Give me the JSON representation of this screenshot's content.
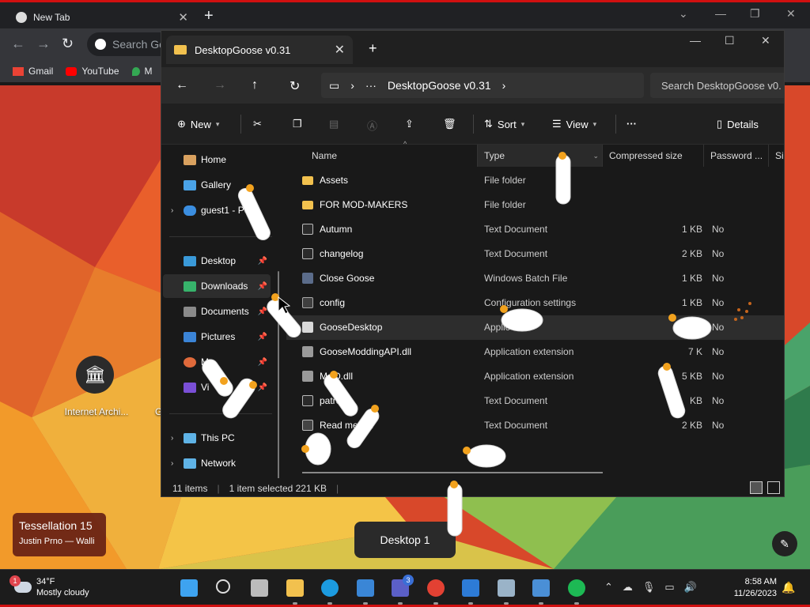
{
  "chrome": {
    "tab_title": "New Tab",
    "omnibox_placeholder": "Search Go",
    "bookmarks": [
      {
        "label": "Gmail",
        "icon": "gmail-icon",
        "color": "#ea4335"
      },
      {
        "label": "YouTube",
        "icon": "youtube-icon",
        "color": "#ff0000"
      },
      {
        "label": "M",
        "icon": "maps-icon",
        "color": "#34a853"
      }
    ]
  },
  "desktop": {
    "icon_label": "Internet Archi...",
    "icon_label_2": "G",
    "wallpaper_title": "Tessellation 15",
    "wallpaper_artist": "Justin Prno — Walli",
    "desktop_pill": "Desktop 1"
  },
  "explorer": {
    "tab_title": "DesktopGoose v0.31",
    "address_path": "DesktopGoose v0.31",
    "search_placeholder": "Search DesktopGoose v0.",
    "commands": {
      "new": "New",
      "sort": "Sort",
      "view": "View",
      "more": "···",
      "details": "Details"
    },
    "nav": [
      {
        "label": "Home",
        "icon": "home-icon",
        "color": "#d9a15f"
      },
      {
        "label": "Gallery",
        "icon": "gallery-icon",
        "color": "#4aa3e8"
      },
      {
        "label": "guest1 - Pe",
        "icon": "onedrive-icon",
        "color": "#3b8ee0"
      },
      {
        "label": "Desktop",
        "icon": "desktop-icon",
        "color": "#3a9ad9"
      },
      {
        "label": "Downloads",
        "icon": "download-icon",
        "color": "#37b36b"
      },
      {
        "label": "Documents",
        "icon": "documents-icon",
        "color": "#8a8a8a"
      },
      {
        "label": "Pictures",
        "icon": "pictures-icon",
        "color": "#3b84d6"
      },
      {
        "label": "M",
        "icon": "music-icon",
        "color": "#e06a3b"
      },
      {
        "label": "Vi",
        "icon": "videos-icon",
        "color": "#7a4fd6"
      },
      {
        "label": "This PC",
        "icon": "pc-icon",
        "color": "#5fb3e6"
      },
      {
        "label": "Network",
        "icon": "network-icon",
        "color": "#5fb3e6"
      }
    ],
    "columns": [
      "Name",
      "Type",
      "Compressed size",
      "Password ...",
      "Siz"
    ],
    "files": [
      {
        "name": "Assets",
        "type": "File folder",
        "size": "",
        "password": "",
        "icon": "ico-folder"
      },
      {
        "name": "FOR MOD-MAKERS",
        "type": "File folder",
        "size": "",
        "password": "",
        "icon": "ico-folder"
      },
      {
        "name": "Autumn",
        "type": "Text Document",
        "size": "1 KB",
        "password": "No",
        "icon": "ico-doc"
      },
      {
        "name": "changelog",
        "type": "Text Document",
        "size": "2 KB",
        "password": "No",
        "icon": "ico-doc"
      },
      {
        "name": "Close Goose",
        "type": "Windows Batch File",
        "size": "1 KB",
        "password": "No",
        "icon": "ico-bat"
      },
      {
        "name": "config",
        "type": "Configuration settings",
        "size": "1 KB",
        "password": "No",
        "icon": "ico-cfg"
      },
      {
        "name": "GooseDesktop",
        "type": "Applic",
        "size": "KB",
        "password": "No",
        "icon": "ico-app"
      },
      {
        "name": "GooseModdingAPI.dll",
        "type": "Application extension",
        "size": "7 K",
        "password": "No",
        "icon": "ico-dll"
      },
      {
        "name": "M  -O.dll",
        "type": "Application extension",
        "size": "5 KB",
        "password": "No",
        "icon": "ico-dll"
      },
      {
        "name": "patro",
        "type": "Text Document",
        "size": "KB",
        "password": "No",
        "icon": "ico-doc"
      },
      {
        "name": "Read me  ink",
        "type": "Text Document",
        "size": "2 KB",
        "password": "No",
        "icon": "ico-lnk"
      }
    ],
    "status": {
      "items": "11 items",
      "selected": "1 item selected  221 KB"
    }
  },
  "taskbar": {
    "weather_temp": "34°F",
    "weather_desc": "Mostly cloudy",
    "weather_badge": "1",
    "time": "8:58 AM",
    "date": "11/26/2023",
    "teams_badge": "3",
    "apps": [
      {
        "name": "start-icon",
        "color": "#3ea3f0"
      },
      {
        "name": "search-icon",
        "color": "#dddddd"
      },
      {
        "name": "task-view-icon",
        "color": "#bbbbbb"
      },
      {
        "name": "file-explorer-icon",
        "color": "#f2c14e"
      },
      {
        "name": "edge-icon",
        "color": "#1c9be0"
      },
      {
        "name": "store-icon",
        "color": "#3a86d6"
      },
      {
        "name": "teams-icon",
        "color": "#5b5fc7"
      },
      {
        "name": "chrome-icon",
        "color": "#e34133"
      },
      {
        "name": "mail-icon",
        "color": "#2d7bd6"
      },
      {
        "name": "archive-icon",
        "color": "#9ab3c8"
      },
      {
        "name": "photos-icon",
        "color": "#4a8fd6"
      },
      {
        "name": "spotify-icon",
        "color": "#1db954"
      }
    ]
  }
}
